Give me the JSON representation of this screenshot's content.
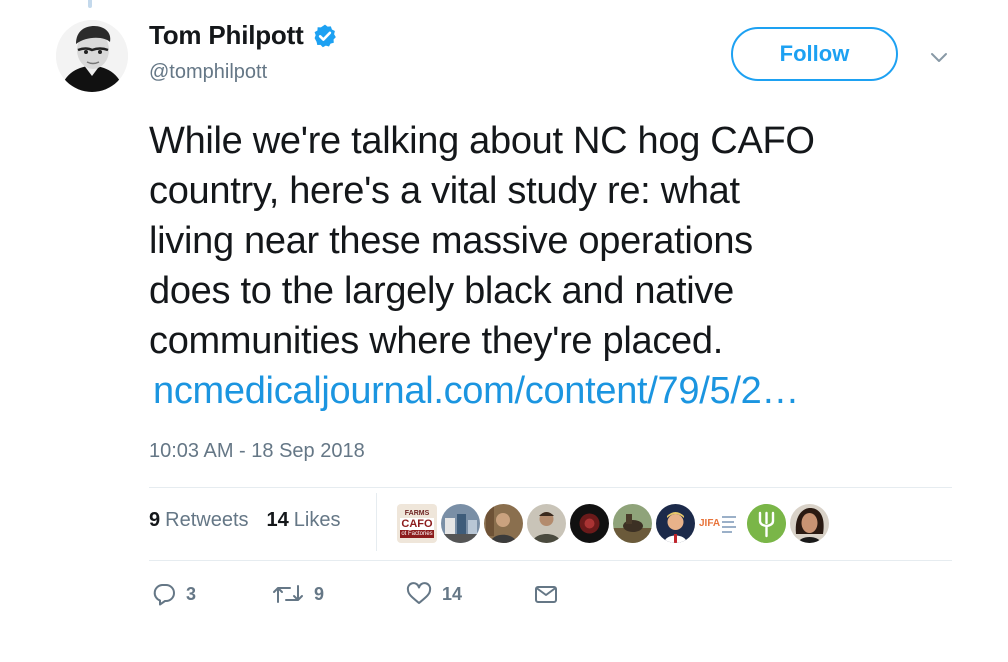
{
  "tweet": {
    "author": {
      "display_name": "Tom Philpott",
      "handle": "@tomphilpott",
      "verified": true
    },
    "follow_label": "Follow",
    "text": "While we're talking about NC hog CAFO\ncountry, here's a vital study re: what\nliving near these massive operations\ndoes to the largely black and native\ncommunities where they're placed.",
    "link_text": "ncmedicaljournal.com/content/79/5/2…",
    "timestamp": "10:03 AM - 18 Sep 2018",
    "stats": {
      "retweets_count": "9",
      "retweets_label": "Retweets",
      "likes_count": "14",
      "likes_label": "Likes"
    },
    "liker_badges": {
      "cafo_top": "FARMS",
      "cafo_main": "CAFO",
      "cafo_sub": "ot Factories",
      "jifa": "JIFA"
    },
    "actions": {
      "reply_count": "3",
      "retweet_count": "9",
      "like_count": "14"
    }
  },
  "colors": {
    "accent": "#1da1f2",
    "link": "#1b95e0",
    "muted": "#657786",
    "text": "#14171a",
    "divider": "#e6ecf0"
  },
  "icons": {
    "verified": "verified-badge-icon",
    "caret": "chevron-down-icon",
    "reply": "reply-icon",
    "retweet": "retweet-icon",
    "like": "heart-icon",
    "message": "envelope-icon"
  }
}
